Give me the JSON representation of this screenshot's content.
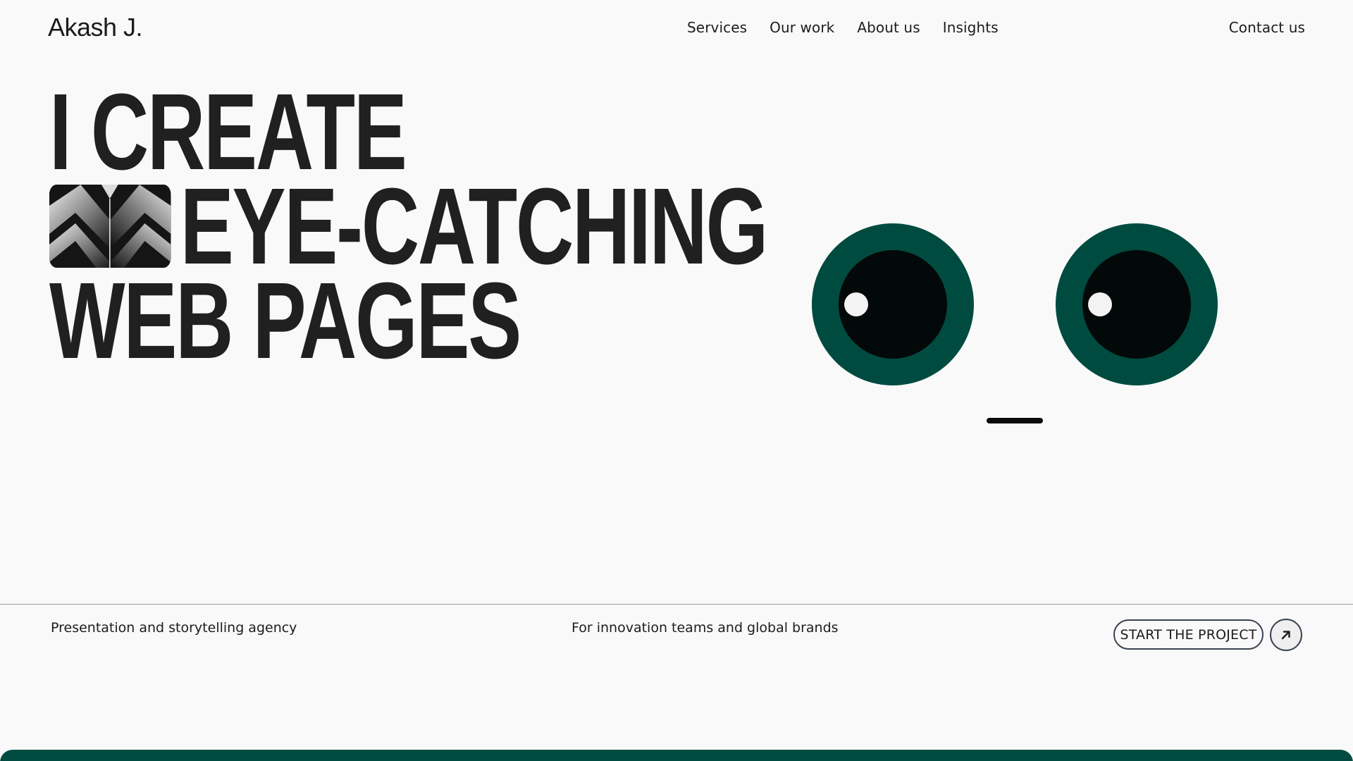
{
  "header": {
    "logo": "Akash J.",
    "nav": [
      "Services",
      "Our work",
      "About us",
      "Insights"
    ],
    "contact": "Contact us"
  },
  "hero": {
    "line1": "I CREATE",
    "line2": "EYE-CATCHING",
    "line3": "WEB PAGES",
    "thumbnail_icon": "abstract-chevron-image"
  },
  "face": {
    "iris_color": "#004b40",
    "pupil_color": "#030808",
    "shine_color": "#f3f3f3"
  },
  "footer_row": {
    "left_tagline": "Presentation and storytelling agency",
    "center_tagline": "For innovation teams and global brands",
    "cta_label": "START THE PROJECT",
    "cta_icon": "arrow-up-right-icon"
  },
  "colors": {
    "background": "#f9f9f9",
    "text": "#1c1c1c",
    "accent": "#004b40"
  }
}
